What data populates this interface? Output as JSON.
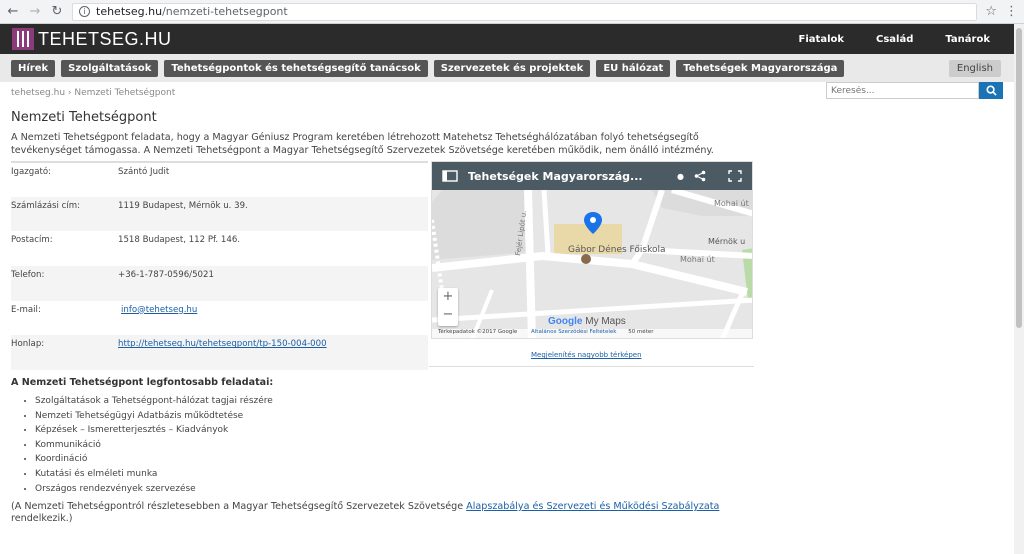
{
  "browser": {
    "url_host": "tehetseg.hu",
    "url_path": "/nemzeti-tehetsegpont"
  },
  "header": {
    "logo_text": "TEHETSEG.HU",
    "top_links": [
      "Fiatalok",
      "Család",
      "Tanárok"
    ]
  },
  "nav": {
    "items": [
      "Hírek",
      "Szolgáltatások",
      "Tehetségpontok és tehetségsegítő tanácsok",
      "Szervezetek és projektek",
      "EU hálózat",
      "Tehetségek Magyarországa"
    ],
    "language": "English"
  },
  "breadcrumb": {
    "home": "tehetseg.hu",
    "separator": "›",
    "current": "Nemzeti Tehetségpont"
  },
  "search": {
    "placeholder": "Keresés..."
  },
  "page": {
    "title": "Nemzeti Tehetségpont",
    "intro": "A Nemzeti Tehetségpont feladata, hogy a Magyar Géniusz Program keretében létrehozott Matehetsz Tehetséghálózatában folyó tehetségsegítő tevékenységet támogassa. A Nemzeti Tehetségpont a Magyar Tehetségsegítő Szervezetek Szövetsége keretében működik, nem önálló intézmény."
  },
  "info": {
    "director_label": "Igazgató:",
    "director": "Szántó Judit",
    "billing_label": "Számlázási cím:",
    "billing": "1119 Budapest, Mérnök u. 39.",
    "postal_label": "Postacím:",
    "postal": "1518 Budapest, 112 Pf. 146.",
    "phone_label": "Telefon:",
    "phone": "+36-1-787-0596/5021",
    "email_label": "E-mail:",
    "email": "info@tehetseg.hu",
    "web_label": "Honlap:",
    "web": "http://tehetseg.hu/tehetsegpont/tp-150-004-000"
  },
  "map": {
    "title": "Tehetségek Magyarország...",
    "place": "Gábor Dénes Főiskola",
    "street1": "Mohai út",
    "street2": "Mérnök u",
    "street3": "Fejér Lipót u.",
    "zoom_in": "+",
    "zoom_out": "−",
    "brand": "Google",
    "brand_suffix": "My Maps",
    "attribution": "Térképadatok ©2017 Google",
    "terms": "Általános Szerződési Feltételek",
    "scale": "50 méter",
    "caption": "Megjelenítés nagyobb térképen"
  },
  "tasks": {
    "title": "A Nemzeti Tehetségpont legfontosabb feladatai:",
    "items": [
      "Szolgáltatások a Tehetségpont-hálózat tagjai részére",
      "Nemzeti Tehetségügyi Adatbázis működtetése",
      "Képzések – Ismeretterjesztés – Kiadványok",
      "Kommunikáció",
      "Koordináció",
      "Kutatási és elméleti munka",
      "Országos rendezvények szervezése"
    ]
  },
  "footnote": {
    "before": "(A Nemzeti Tehetségpontról részletesebben a Magyar Tehetségsegítő Szervezetek Szövetsége ",
    "link": "Alapszabálya és Szervezeti és Működési Szabályzata",
    "after": " rendelkezik.)"
  },
  "colors": {
    "header_bg": "#2b2b2b",
    "logo_accent": "#8b3a7a",
    "link": "#1a5fa8",
    "map_header": "#4b5a63"
  }
}
